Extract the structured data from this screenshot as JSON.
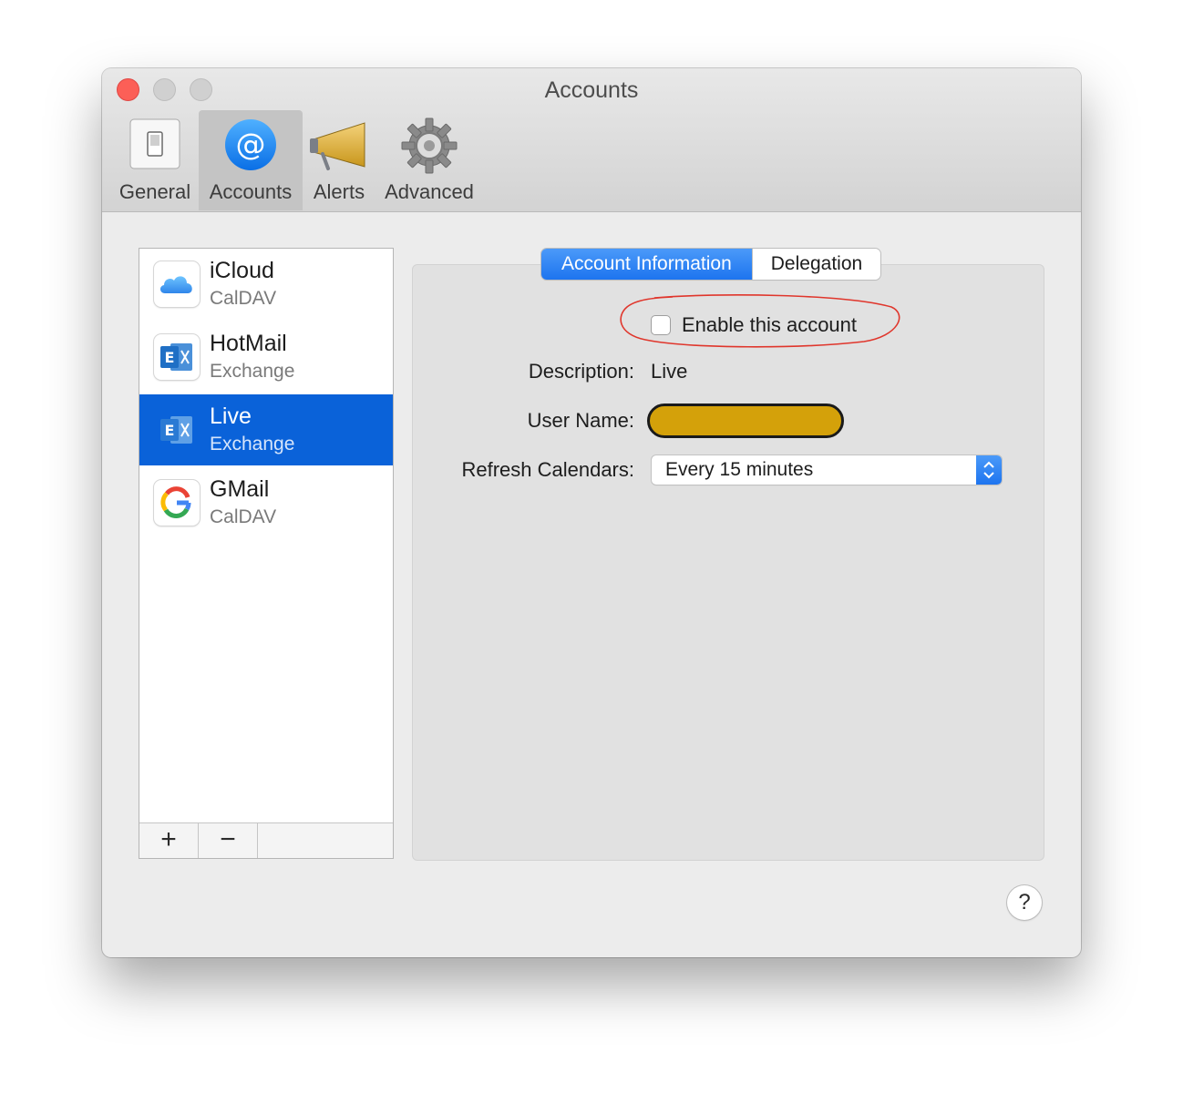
{
  "window": {
    "title": "Accounts"
  },
  "toolbar": {
    "items": [
      {
        "label": "General",
        "icon": "general-switch-icon",
        "selected": false
      },
      {
        "label": "Accounts",
        "icon": "at-sign-icon",
        "selected": true
      },
      {
        "label": "Alerts",
        "icon": "megaphone-icon",
        "selected": false
      },
      {
        "label": "Advanced",
        "icon": "gear-icon",
        "selected": false
      }
    ]
  },
  "accounts": [
    {
      "name": "iCloud",
      "type": "CalDAV",
      "icon": "icloud-icon",
      "selected": false
    },
    {
      "name": "HotMail",
      "type": "Exchange",
      "icon": "exchange-icon",
      "selected": false
    },
    {
      "name": "Live",
      "type": "Exchange",
      "icon": "exchange-icon",
      "selected": true
    },
    {
      "name": "GMail",
      "type": "CalDAV",
      "icon": "google-icon",
      "selected": false
    }
  ],
  "list_buttons": {
    "add": "+",
    "remove": "−"
  },
  "tabs": [
    {
      "label": "Account Information",
      "active": true
    },
    {
      "label": "Delegation",
      "active": false
    }
  ],
  "form": {
    "enable_label": "Enable this account",
    "enable_checked": false,
    "description_label": "Description:",
    "description_value": "Live",
    "username_label": "User Name:",
    "refresh_label": "Refresh Calendars:",
    "refresh_value": "Every 15 minutes"
  },
  "help": {
    "label": "?"
  },
  "colors": {
    "selection": "#0a62d9",
    "accent": "#1d74ef",
    "annotation": "#e0362c",
    "redaction": "#d4a10a"
  }
}
